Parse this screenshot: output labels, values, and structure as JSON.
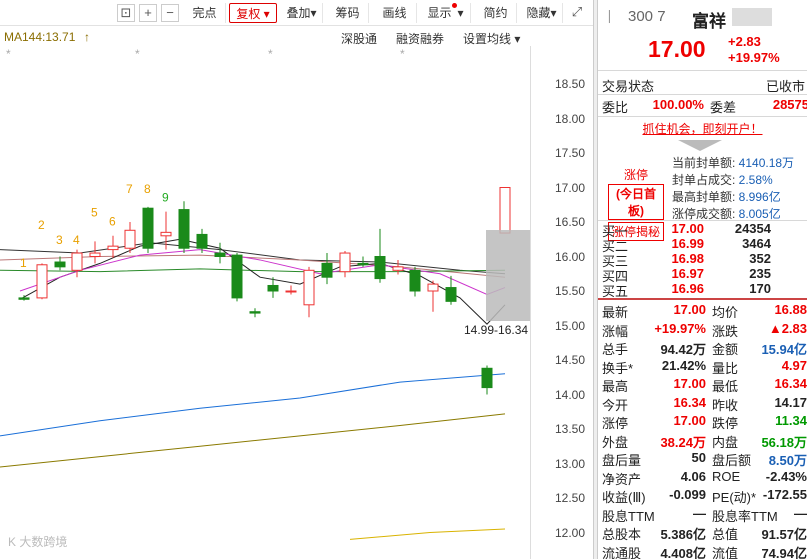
{
  "toolbar": {
    "buttons": [
      "完点",
      "复权",
      "叠加",
      "筹码",
      "画线",
      "显示",
      "简约",
      "隐藏"
    ],
    "active": "复权"
  },
  "chart": {
    "ma_label": "MA144:13.71",
    "options": [
      "深股通",
      "融资融券",
      "设置均线"
    ],
    "yticks": [
      "18.50",
      "18.00",
      "17.50",
      "17.00",
      "16.50",
      "16.00",
      "15.50",
      "15.00",
      "14.50",
      "14.00",
      "13.50",
      "13.00",
      "12.50",
      "12.00"
    ],
    "range_label": "14.99-16.34",
    "count_labels": [
      "1",
      "2",
      "3",
      "4",
      "5",
      "6",
      "7",
      "8",
      "9"
    ],
    "watermark": "K 大数跨境"
  },
  "stock": {
    "code": "300  7",
    "name": "富祥",
    "price": "17.00",
    "change": "+2.83",
    "change_pct": "+19.97%"
  },
  "status": {
    "label": "交易状态",
    "value": "已收市",
    "weibi_label": "委比",
    "weibi": "100.00%",
    "weicha_label": "委差",
    "weicha": "28575",
    "promo": "抓住机会，即刻开户！"
  },
  "limit": {
    "badge1": "涨停",
    "badge2": "(今日首板)",
    "badge3": "涨停揭秘",
    "items": [
      {
        "k": "当前封单额:",
        "v": "4140.18万"
      },
      {
        "k": "封单占成交:",
        "v": "2.58%"
      },
      {
        "k": "最高封单额:",
        "v": "8.996亿"
      },
      {
        "k": "涨停成交额:",
        "v": "8.005亿"
      }
    ]
  },
  "orderbook": [
    {
      "k": "买一",
      "p": "17.00",
      "q": "24354"
    },
    {
      "k": "买二",
      "p": "16.99",
      "q": "3464"
    },
    {
      "k": "买三",
      "p": "16.98",
      "q": "352"
    },
    {
      "k": "买四",
      "p": "16.97",
      "q": "235"
    },
    {
      "k": "买五",
      "p": "16.96",
      "q": "170"
    }
  ],
  "stats": [
    {
      "k1": "最新",
      "v1": "17.00",
      "c1": "red",
      "k2": "均价",
      "v2": "16.88",
      "c2": "red"
    },
    {
      "k1": "涨幅",
      "v1": "+19.97%",
      "c1": "red",
      "k2": "涨跌",
      "v2": "▲2.83",
      "c2": "red"
    },
    {
      "k1": "总手",
      "v1": "94.42万",
      "c1": "black",
      "k2": "金额",
      "v2": "15.94亿",
      "c2": "blue"
    },
    {
      "k1": "换手*",
      "v1": "21.42%",
      "c1": "black",
      "k2": "量比",
      "v2": "4.97",
      "c2": "red"
    },
    {
      "k1": "最高",
      "v1": "17.00",
      "c1": "red",
      "k2": "最低",
      "v2": "16.34",
      "c2": "red"
    },
    {
      "k1": "今开",
      "v1": "16.34",
      "c1": "red",
      "k2": "昨收",
      "v2": "14.17",
      "c2": "black"
    },
    {
      "k1": "涨停",
      "v1": "17.00",
      "c1": "red",
      "k2": "跌停",
      "v2": "11.34",
      "c2": "green"
    },
    {
      "k1": "外盘",
      "v1": "38.24万",
      "c1": "red",
      "k2": "内盘",
      "v2": "56.18万",
      "c2": "green"
    },
    {
      "k1": "盘后量",
      "v1": "50",
      "c1": "black",
      "k2": "盘后额",
      "v2": "8.50万",
      "c2": "blue"
    },
    {
      "k1": "净资产",
      "v1": "4.06",
      "c1": "black",
      "k2": "ROE",
      "v2": "-2.43%",
      "c2": "black"
    },
    {
      "k1": "收益(Ⅲ)",
      "v1": "-0.099",
      "c1": "black",
      "k2": "PE(动)*",
      "v2": "-172.55",
      "c2": "black"
    },
    {
      "k1": "股息TTM",
      "v1": "—",
      "c1": "black",
      "k2": "股息率TTM",
      "v2": "—",
      "c2": "black"
    },
    {
      "k1": "总股本",
      "v1": "5.386亿",
      "c1": "black",
      "k2": "总值",
      "v2": "91.57亿",
      "c2": "black"
    },
    {
      "k1": "流通股",
      "v1": "4.408亿",
      "c1": "black",
      "k2": "流值",
      "v2": "74.94亿",
      "c2": "black"
    }
  ]
}
